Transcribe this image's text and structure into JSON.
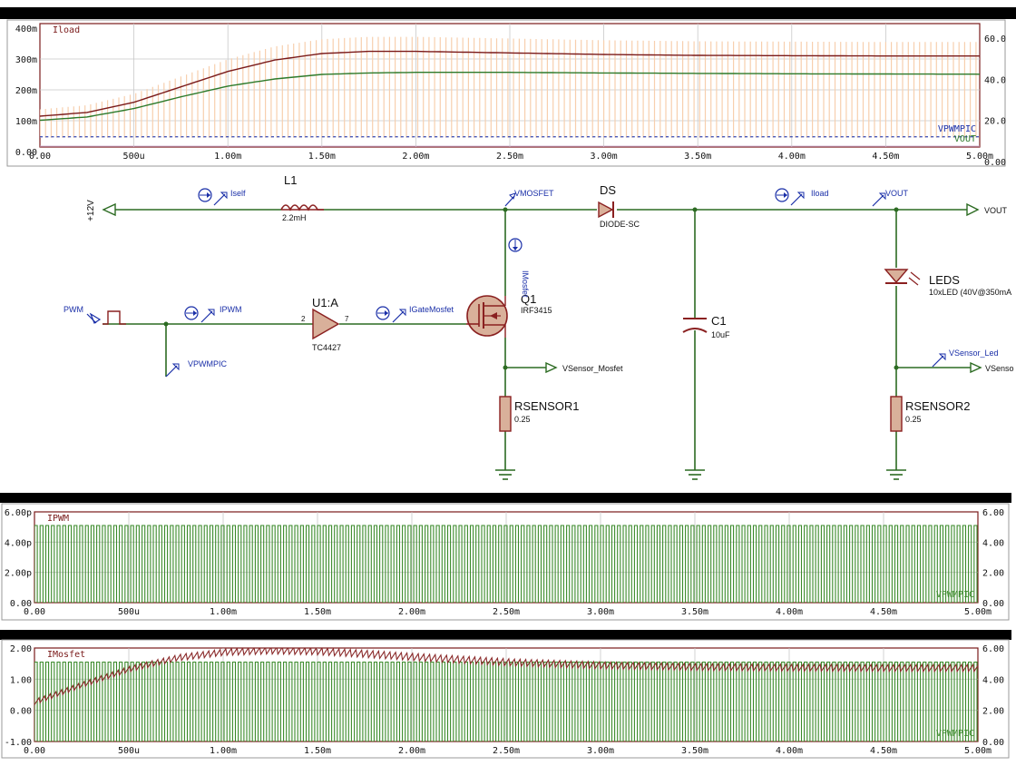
{
  "colors": {
    "wire": "#2c6b22",
    "component": "#8a2020",
    "component_fill": "#d9b09a",
    "probe": "#1a2fa8",
    "plot_border": "#7a1a1a",
    "grid": "#c8c8c8",
    "trace_iload": "#7a1a1a",
    "trace_vout": "#2d7a2a",
    "trace_pwm_faint": "#f7cfae",
    "trace_vpwm": "#1a2fa8",
    "trace_green": "#3a8a2a",
    "trace_red": "#8a2a2a"
  },
  "schematic": {
    "supply": "+12V",
    "L1": {
      "name": "L1",
      "value": "2.2mH"
    },
    "DS": {
      "name": "DS",
      "value": "DIODE-SC"
    },
    "Q1": {
      "name": "Q1",
      "value": "IRF3415"
    },
    "U1": {
      "name": "U1:A",
      "value": "TC4427",
      "pin_in": "2",
      "pin_out": "7"
    },
    "C1": {
      "name": "C1",
      "value": "10uF"
    },
    "LEDS": {
      "name": "LEDS",
      "value": "10xLED (40V@350mA"
    },
    "RSENSOR1": {
      "name": "RSENSOR1",
      "value": "0.25"
    },
    "RSENSOR2": {
      "name": "RSENSOR2",
      "value": "0.25"
    },
    "probes": {
      "iself": "Iself",
      "vmosfet": "VMOSFET",
      "iload": "Iload",
      "vout": "VOUT",
      "vout_term": "VOUT",
      "pwm": "PWM",
      "ipwm": "IPWM",
      "igate": "IGateMosfet",
      "imosfet": "IMosfet",
      "vpwmpic": "VPWMPIC",
      "vsensor_mosfet": "VSensor_Mosfet",
      "vsensor_led": "VSensor_Led",
      "vsenso": "VSenso"
    }
  },
  "chart_data": [
    {
      "type": "line",
      "x_ticks": [
        "0.00",
        "500u",
        "1.00m",
        "1.50m",
        "2.00m",
        "2.50m",
        "3.00m",
        "3.50m",
        "4.00m",
        "4.50m",
        "5.00m"
      ],
      "y_ticks_left": [
        "400m",
        "300m",
        "200m",
        "100m",
        "0.00"
      ],
      "y_ticks_right": [
        "60.0",
        "40.0",
        "20.0",
        "0.00"
      ],
      "xlim": [
        0,
        0.005
      ],
      "ylim_left": [
        0,
        0.4
      ],
      "ylim_right": [
        0,
        60
      ],
      "grid": true,
      "legend_left": [
        "Iload"
      ],
      "legend_right": [
        "VPWMPIC",
        "VOUT"
      ],
      "series": [
        {
          "name": "Iload",
          "axis": "left",
          "x": [
            0,
            0.00025,
            0.0005,
            0.00075,
            0.001,
            0.00125,
            0.0015,
            0.00175,
            0.002,
            0.0025,
            0.003,
            0.0035,
            0.004,
            0.0045,
            0.005
          ],
          "values": [
            0.1,
            0.112,
            0.145,
            0.195,
            0.245,
            0.282,
            0.303,
            0.31,
            0.31,
            0.305,
            0.3,
            0.297,
            0.296,
            0.295,
            0.295
          ]
        },
        {
          "name": "VOUT",
          "axis": "right",
          "x": [
            0,
            0.00025,
            0.0005,
            0.00075,
            0.001,
            0.00125,
            0.0015,
            0.00175,
            0.002,
            0.0025,
            0.003,
            0.0035,
            0.004,
            0.0045,
            0.005
          ],
          "values": [
            13,
            14.6,
            18.7,
            24.4,
            29.6,
            33.1,
            35.3,
            36,
            36.3,
            36.3,
            36,
            35.8,
            35.6,
            35.5,
            35.4
          ]
        }
      ]
    },
    {
      "type": "line",
      "x_ticks": [
        "0.00",
        "500u",
        "1.00m",
        "1.50m",
        "2.00m",
        "2.50m",
        "3.00m",
        "3.50m",
        "4.00m",
        "4.50m",
        "5.00m"
      ],
      "y_ticks_left": [
        "6.00p",
        "4.00p",
        "2.00p",
        "0.00"
      ],
      "y_ticks_right": [
        "6.00",
        "4.00",
        "2.00",
        "0.00"
      ],
      "xlim": [
        0,
        0.005
      ],
      "ylim_left": [
        0,
        6e-12
      ],
      "ylim_right": [
        0,
        6
      ],
      "grid": true,
      "legend_left": [
        "IPWM"
      ],
      "legend_right": [
        "VPWMPIC"
      ],
      "pwm": {
        "period": 3e-05,
        "high": 5,
        "low": 0,
        "duty": 0.5
      },
      "series": [
        {
          "name": "VPWMPIC",
          "axis": "right",
          "waveform": "square",
          "high": 5,
          "low": 0
        }
      ]
    },
    {
      "type": "line",
      "x_ticks": [
        "0.00",
        "500u",
        "1.00m",
        "1.50m",
        "2.00m",
        "2.50m",
        "3.00m",
        "3.50m",
        "4.00m",
        "4.50m",
        "5.00m"
      ],
      "y_ticks_left": [
        "2.00",
        "1.00",
        "0.00",
        "-1.00"
      ],
      "y_ticks_right": [
        "6.00",
        "4.00",
        "2.00",
        "0.00"
      ],
      "xlim": [
        0,
        0.005
      ],
      "ylim_left": [
        -1,
        2
      ],
      "ylim_right": [
        0,
        6
      ],
      "grid": true,
      "legend_left": [
        "IMosfet"
      ],
      "legend_right": [
        "VPWMPIC"
      ],
      "series": [
        {
          "name": "IMosfet",
          "axis": "left",
          "x": [
            0,
            0.00025,
            0.0005,
            0.00075,
            0.001,
            0.00125,
            0.0015,
            0.00175,
            0.002,
            0.0025,
            0.003,
            0.0035,
            0.004,
            0.0045,
            0.005
          ],
          "values": [
            0.3,
            0.85,
            1.35,
            1.7,
            1.88,
            1.93,
            1.9,
            1.82,
            1.72,
            1.55,
            1.45,
            1.4,
            1.38,
            1.37,
            1.37
          ]
        },
        {
          "name": "VPWMPIC",
          "axis": "right",
          "waveform": "square",
          "high": 5,
          "low": 0
        }
      ]
    }
  ]
}
